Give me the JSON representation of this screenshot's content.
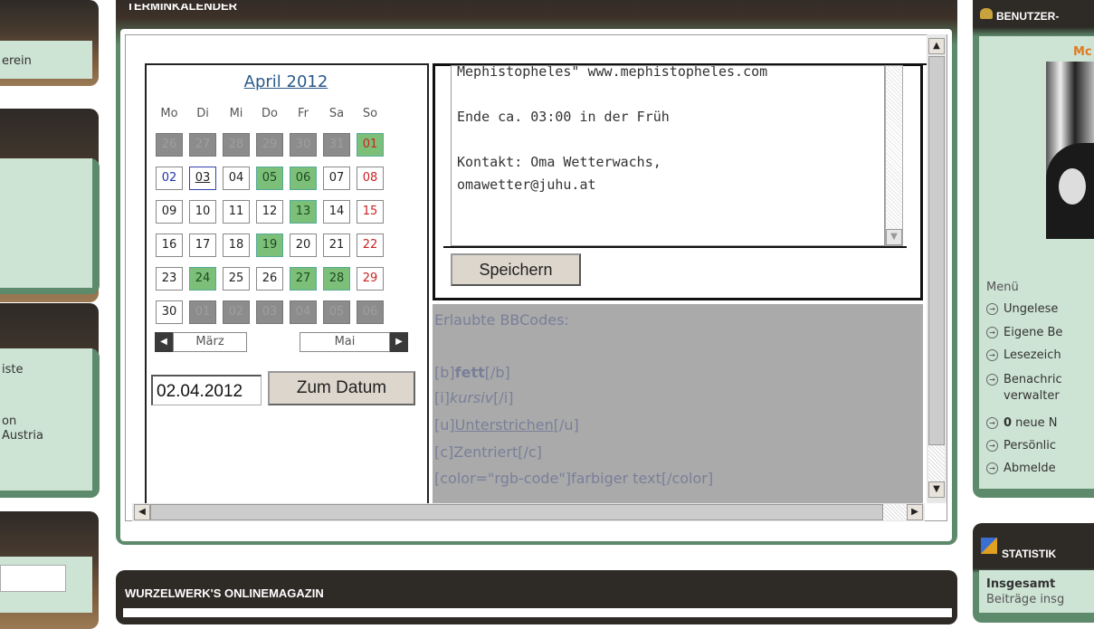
{
  "left_sidebar": {
    "item_verein": "erein",
    "item_liste": "iste",
    "item_on": "on",
    "item_austria": "Austria"
  },
  "terminkalender": {
    "header_title": "TERMINKALENDER",
    "month_title": "April 2012",
    "weekdays": [
      "Mo",
      "Di",
      "Mi",
      "Do",
      "Fr",
      "Sa",
      "So"
    ],
    "weeks": [
      [
        "26",
        "27",
        "28",
        "29",
        "30",
        "31",
        "01"
      ],
      [
        "02",
        "03",
        "04",
        "05",
        "06",
        "07",
        "08"
      ],
      [
        "09",
        "10",
        "11",
        "12",
        "13",
        "14",
        "15"
      ],
      [
        "16",
        "17",
        "18",
        "19",
        "20",
        "21",
        "22"
      ],
      [
        "23",
        "24",
        "25",
        "26",
        "27",
        "28",
        "29"
      ],
      [
        "30",
        "01",
        "02",
        "03",
        "04",
        "05",
        "06"
      ]
    ],
    "prev_month": "März",
    "next_month": "Mai",
    "date_value": "02.04.2012",
    "goto_button": "Zum Datum",
    "event_lines": [
      "Mephistopheles\" www.mephistopheles.com",
      "",
      "Ende ca. 03:00 in der Früh",
      "",
      "Kontakt: Oma Wetterwachs,",
      "omawetter@juhu.at"
    ],
    "save_button": "Speichern",
    "bbcodes_title": "Erlaubte BBCodes:",
    "bbcodes": {
      "bold_open": "[b]",
      "bold_text": "fett",
      "bold_close": "[/b]",
      "italic_open": "[i]",
      "italic_text": "kursiv",
      "italic_close": "[/i]",
      "under_open": "[u]",
      "under_text": "Unterstrichen",
      "under_close": "[/u]",
      "center_open": "[c]",
      "center_text": "Zentriert",
      "center_close": "[/c]",
      "color_line": "[color=\"rgb-code\"]farbiger text[/color]"
    }
  },
  "onlinemagazin": {
    "header_title": "WURZELWERK'S ONLINEMAGAZIN"
  },
  "benutzer": {
    "header_title": "BENUTZER-",
    "user_name_partial": "Mc",
    "menu_label": "Menü",
    "menu_items": [
      "Ungelese",
      "Eigene Be",
      "Lesezeich",
      "Benachric",
      "verwalter",
      "0",
      "neue N",
      "Persönlic",
      "Abmelde"
    ]
  },
  "statistik": {
    "header_title": "STATISTIK",
    "insgesamt": "Insgesamt",
    "beitraege": "Beiträge insg"
  },
  "colors": {
    "dark_header": "#2e2a26",
    "green_frame": "#5d8a6a",
    "mint": "#cde3d4",
    "highlight_green": "#7cbf78",
    "weekend_red": "#cc2222",
    "link_blue": "#2a5a8a"
  }
}
